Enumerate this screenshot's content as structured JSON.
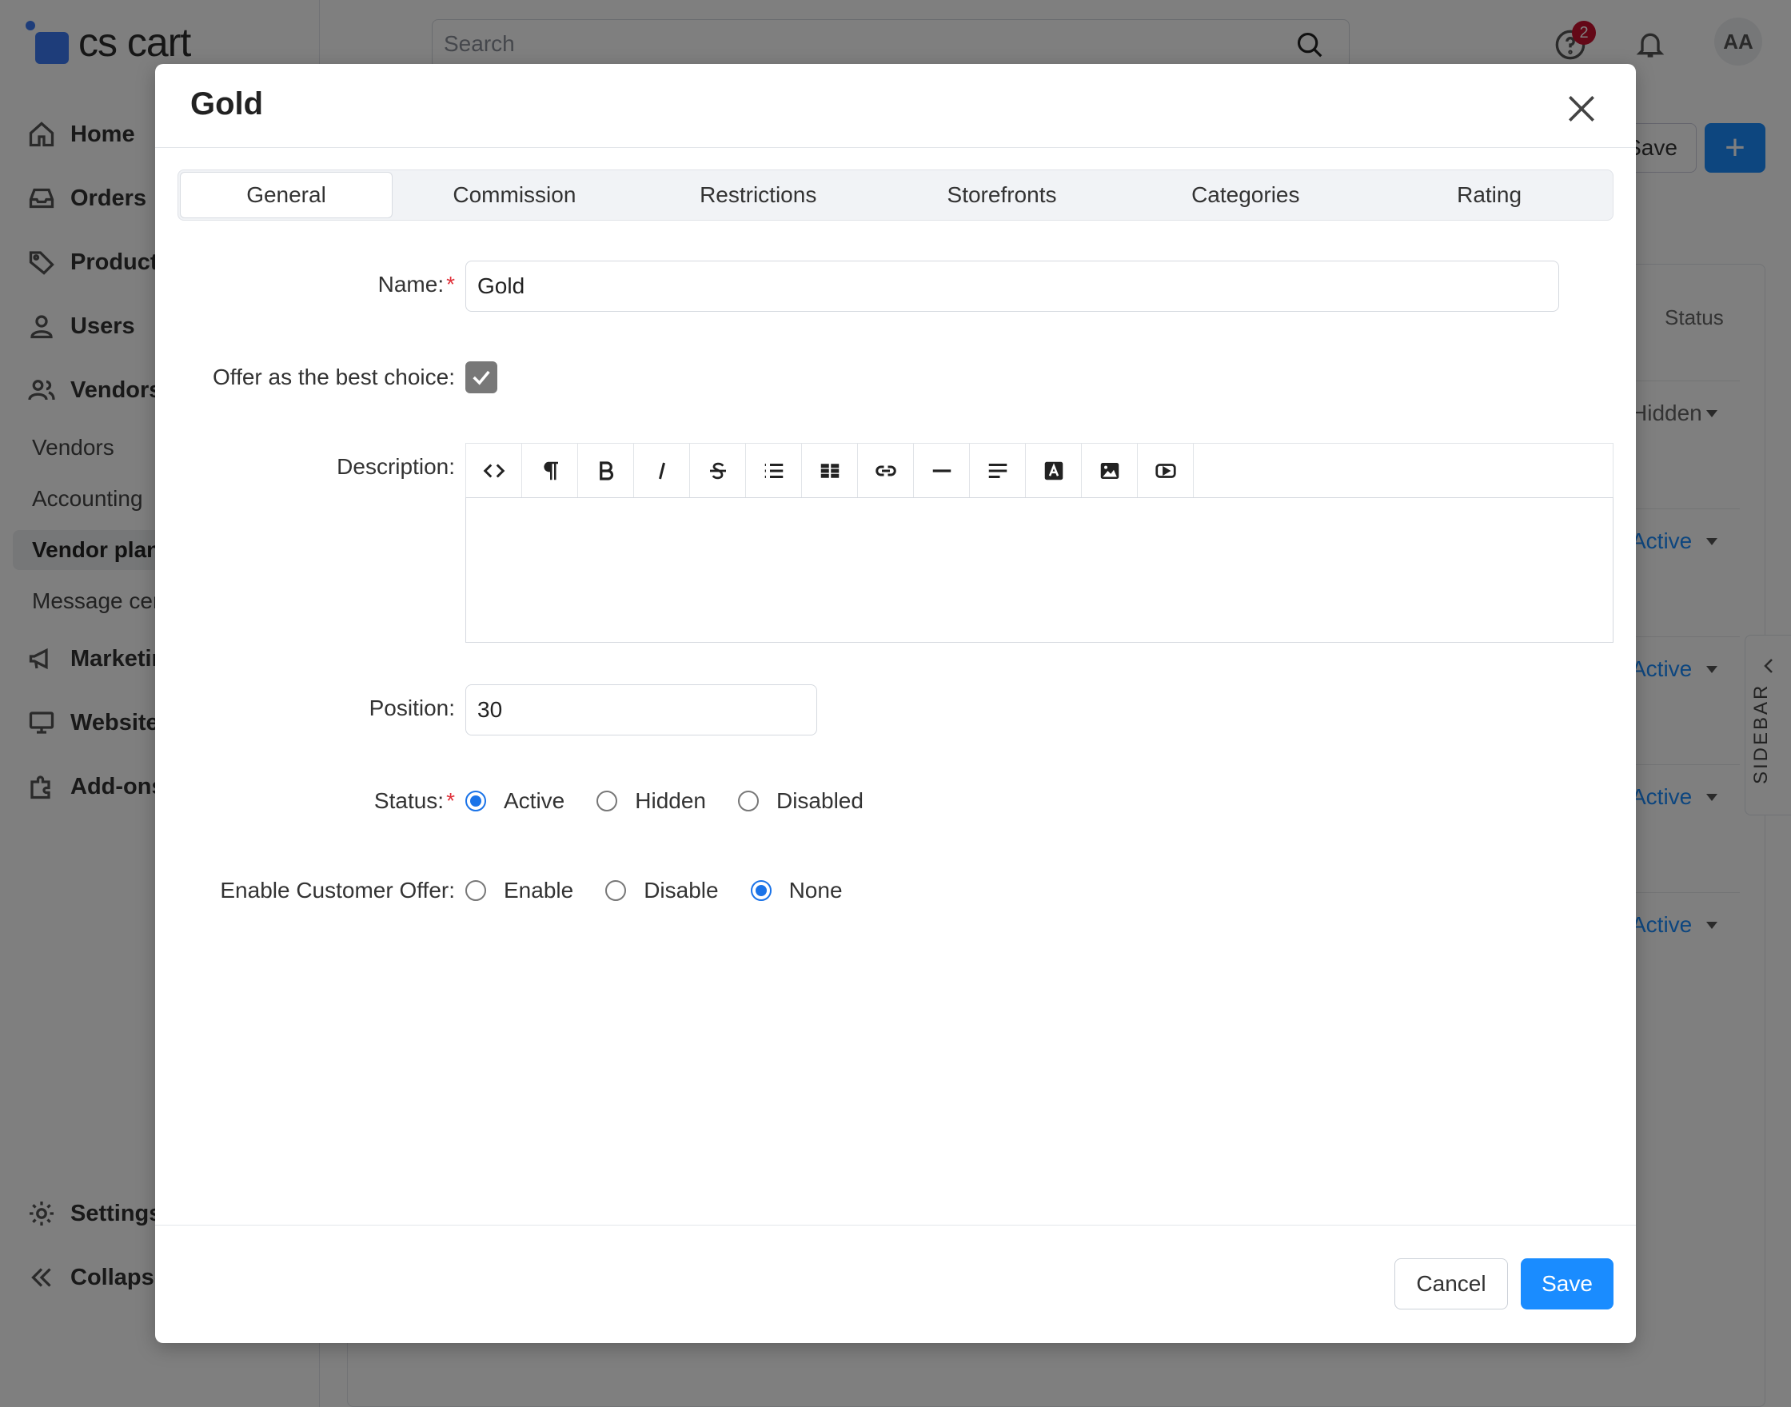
{
  "app": {
    "logo_text": "cs cart",
    "nav": [
      {
        "label": "Home",
        "icon": "home-icon"
      },
      {
        "label": "Orders",
        "icon": "inbox-icon"
      },
      {
        "label": "Products",
        "icon": "tag-icon"
      },
      {
        "label": "Users",
        "icon": "user-icon"
      },
      {
        "label": "Vendors",
        "icon": "users-icon"
      }
    ],
    "vendor_sub": [
      "Vendors",
      "Accounting",
      "Vendor plans",
      "Message center"
    ],
    "nav_lower": [
      {
        "label": "Marketing",
        "icon": "megaphone-icon"
      },
      {
        "label": "Website",
        "icon": "monitor-icon"
      },
      {
        "label": "Add-ons",
        "icon": "puzzle-icon"
      }
    ],
    "settings_label": "Settings",
    "collapse_label": "Collapse"
  },
  "topbar": {
    "search_placeholder": "Search",
    "help_badge": "2",
    "avatar_initials": "AA",
    "save_label": "Save",
    "add_label": "+"
  },
  "background": {
    "status_header": "Status",
    "rows": [
      "Hidden",
      "Active",
      "Active",
      "Active",
      "Active"
    ]
  },
  "sidebar_toggle_label": "SIDEBAR",
  "modal": {
    "title": "Gold",
    "tabs": [
      "General",
      "Commission",
      "Restrictions",
      "Storefronts",
      "Categories",
      "Rating"
    ],
    "active_tab": "General",
    "fields": {
      "name_label": "Name:",
      "name_value": "Gold",
      "best_choice_label": "Offer as the best choice:",
      "best_choice_checked": true,
      "description_label": "Description:",
      "position_label": "Position:",
      "position_value": "30",
      "status_label": "Status:",
      "status_options": [
        "Active",
        "Hidden",
        "Disabled"
      ],
      "status_selected": "Active",
      "customer_offer_label": "Enable Customer Offer:",
      "customer_offer_options": [
        "Enable",
        "Disable",
        "None"
      ],
      "customer_offer_selected": "None"
    },
    "editor_toolbar": [
      {
        "name": "code-view-icon",
        "glyph": "<>"
      },
      {
        "name": "paragraph-icon",
        "glyph": "¶"
      },
      {
        "name": "bold-icon",
        "glyph": "B"
      },
      {
        "name": "italic-icon",
        "glyph": "I"
      },
      {
        "name": "strikethrough-icon",
        "glyph": "S"
      },
      {
        "name": "bullet-list-icon",
        "glyph": ""
      },
      {
        "name": "table-icon",
        "glyph": ""
      },
      {
        "name": "link-icon",
        "glyph": ""
      },
      {
        "name": "horizontal-rule-icon",
        "glyph": ""
      },
      {
        "name": "align-icon",
        "glyph": ""
      },
      {
        "name": "text-color-icon",
        "glyph": "A"
      },
      {
        "name": "image-icon",
        "glyph": ""
      },
      {
        "name": "video-icon",
        "glyph": ""
      }
    ],
    "cancel_label": "Cancel",
    "save_label": "Save"
  },
  "colors": {
    "accent": "#1a8cff",
    "radio_checked": "#1a73e8",
    "required": "#e0313a",
    "badge": "#c8102e"
  }
}
